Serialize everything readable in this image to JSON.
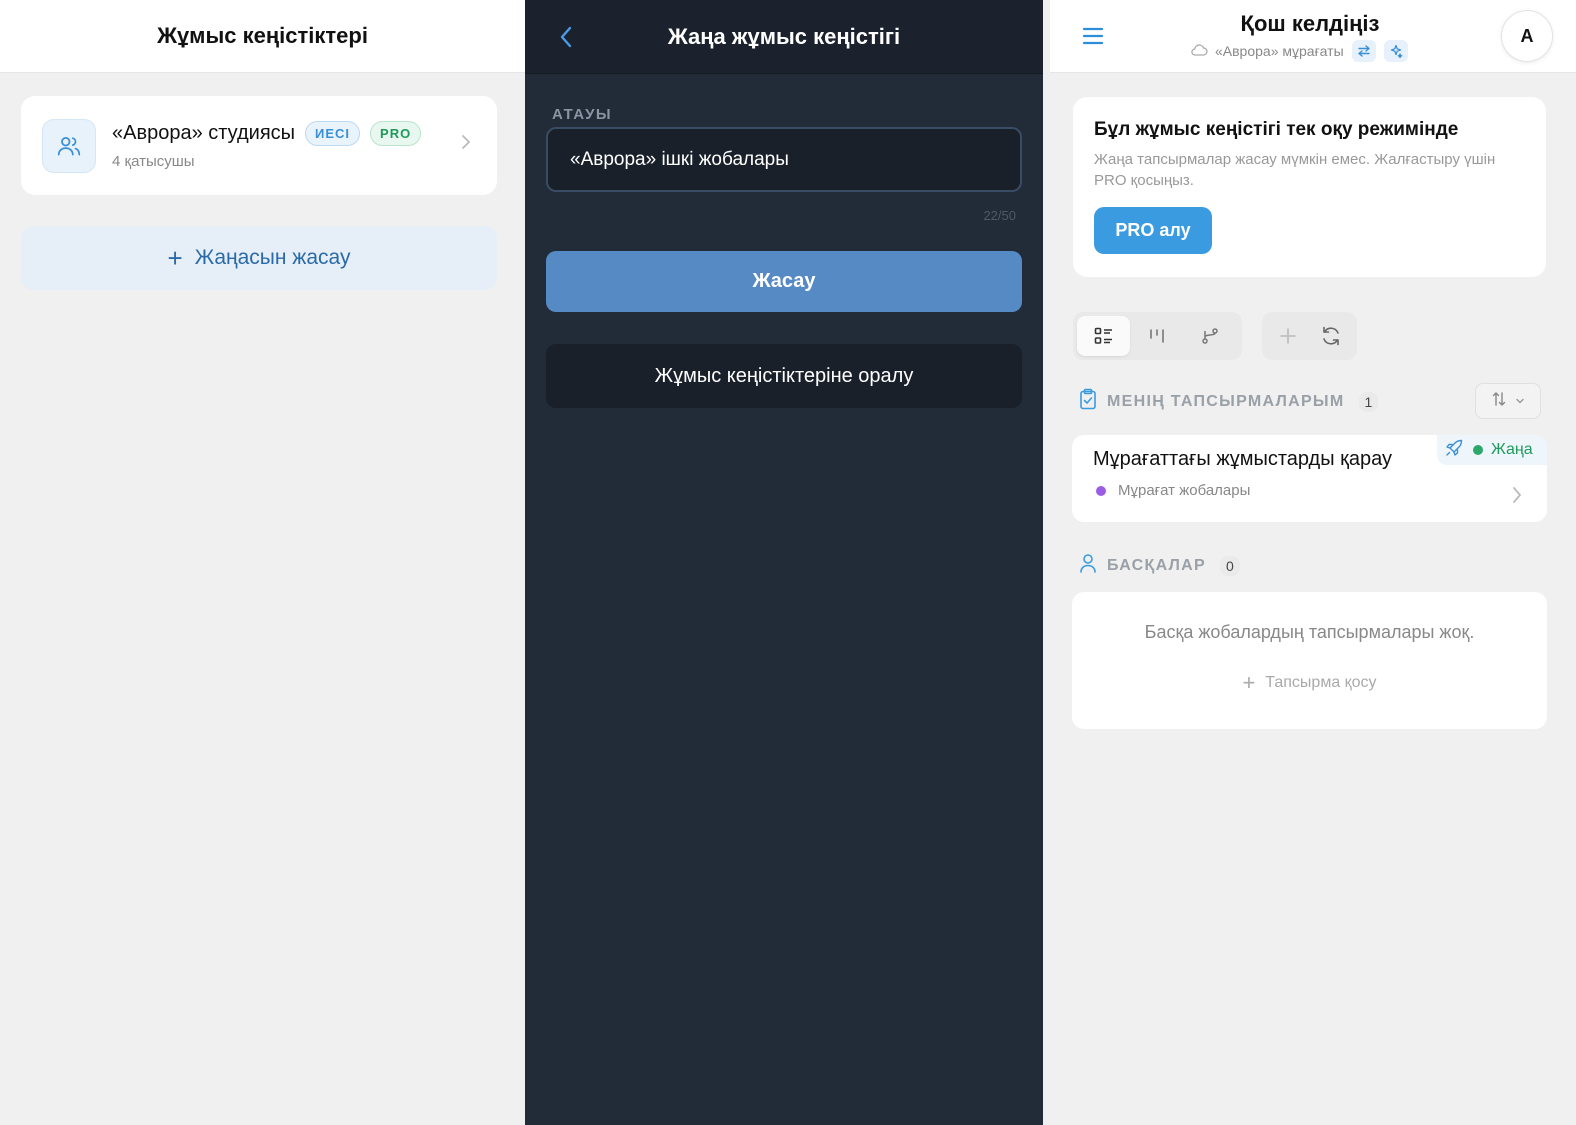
{
  "workspaces_panel": {
    "title": "Жұмыс кеңістіктері",
    "workspace": {
      "name": "«Аврора» студиясы",
      "owner_badge": "ИЕСІ",
      "plan_badge": "PRO",
      "members": "4 қатысушы"
    },
    "create_new_label": "Жаңасын жасау"
  },
  "new_workspace_panel": {
    "title": "Жаңа жұмыс кеңістігі",
    "name_label": "АТАУЫ",
    "name_value": "«Аврора» ішкі жобалары",
    "char_count": "22/50",
    "create_button": "Жасау",
    "back_button": "Жұмыс кеңістіктеріне оралу"
  },
  "home_panel": {
    "title": "Қош келдіңіз",
    "workspace_name": "«Аврора» мұрағаты",
    "avatar_initial": "A",
    "readonly_notice": {
      "title": "Бұл жұмыс кеңістігі тек оқу режимінде",
      "description": "Жаңа тапсырмалар жасау мүмкін емес. Жалғастыру үшін PRO қосыңыз.",
      "button": "PRO алу"
    },
    "my_tasks": {
      "title": "МЕНІҢ ТАПСЫРМАЛАРЫМ",
      "count": "1",
      "tasks": [
        {
          "title": "Мұрағаттағы жұмыстарды қарау",
          "project": "Мұрағат жобалары",
          "status": "Жаңа"
        }
      ]
    },
    "others": {
      "title": "БАСҚАЛАР",
      "count": "0",
      "empty_text": "Басқа жобалардың тапсырмалары жоқ.",
      "add_task": "Тапсырма қосу"
    }
  },
  "colors": {
    "accent_blue": "#3b9be0",
    "status_green": "#2ca86a",
    "project_purple": "#9b5de5",
    "dark_bg": "#222b38"
  }
}
